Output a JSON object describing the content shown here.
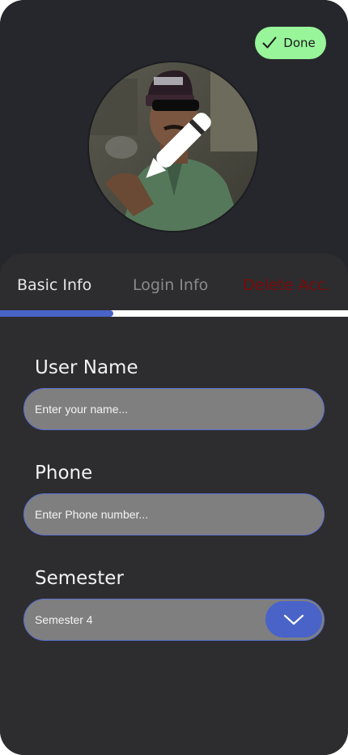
{
  "header": {
    "done_label": "Done",
    "done_icon": "checkmark-icon",
    "edit_icon": "pencil-icon"
  },
  "tabs": [
    {
      "label": "Basic Info",
      "state": "active"
    },
    {
      "label": "Login Info",
      "state": "inactive"
    },
    {
      "label": "Delete Acc.",
      "state": "danger"
    }
  ],
  "form": {
    "username": {
      "label": "User Name",
      "placeholder": "Enter your name..."
    },
    "phone": {
      "label": "Phone",
      "placeholder": "Enter Phone number..."
    },
    "semester": {
      "label": "Semester",
      "value": "Semester 4",
      "icon": "chevron-down-icon"
    }
  },
  "colors": {
    "accent": "#4a63c8",
    "done_bg": "#98f59a",
    "danger": "#7a0a0a",
    "background": "#2d2d2f"
  }
}
